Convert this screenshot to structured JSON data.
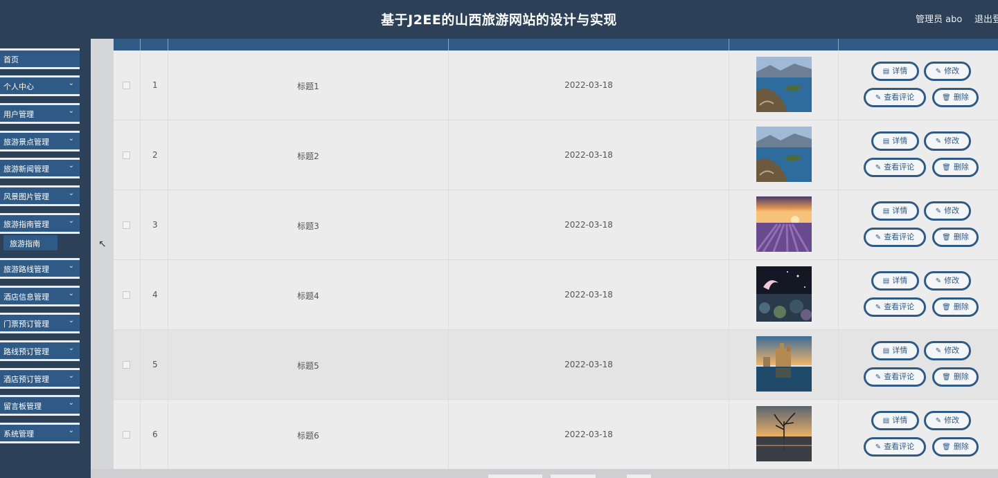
{
  "header": {
    "title": "基于J2EE的山西旅游网站的设计与实现",
    "user": "管理员 abo",
    "logout": "退出登"
  },
  "sidebar": {
    "items": [
      {
        "label": "首页",
        "has_chevron": false
      },
      {
        "label": "个人中心",
        "has_chevron": true
      },
      {
        "label": "用户管理",
        "has_chevron": true
      },
      {
        "label": "旅游景点管理",
        "has_chevron": true
      },
      {
        "label": "旅游新闻管理",
        "has_chevron": true
      },
      {
        "label": "风景图片管理",
        "has_chevron": true
      },
      {
        "label": "旅游指南管理",
        "has_chevron": true
      },
      {
        "label": "旅游路线管理",
        "has_chevron": true
      },
      {
        "label": "酒店信息管理",
        "has_chevron": true
      },
      {
        "label": "门票预订管理",
        "has_chevron": true
      },
      {
        "label": "路线预订管理",
        "has_chevron": true
      },
      {
        "label": "酒店预订管理",
        "has_chevron": true
      },
      {
        "label": "留言板管理",
        "has_chevron": true
      },
      {
        "label": "系统管理",
        "has_chevron": true
      }
    ],
    "submenu": {
      "label": "旅游指南"
    }
  },
  "buttons": {
    "detail": "详情",
    "edit": "修改",
    "comments": "查看评论",
    "delete": "删除"
  },
  "table": {
    "rows": [
      {
        "index": "1",
        "title": "标题1",
        "date": "2022-03-18",
        "image": "lake-peninsula"
      },
      {
        "index": "2",
        "title": "标题2",
        "date": "2022-03-18",
        "image": "lake-peninsula"
      },
      {
        "index": "3",
        "title": "标题3",
        "date": "2022-03-18",
        "image": "lavender-field"
      },
      {
        "index": "4",
        "title": "标题4",
        "date": "2022-03-18",
        "image": "night-garden"
      },
      {
        "index": "5",
        "title": "标题5",
        "date": "2022-03-18",
        "image": "castle-lake"
      },
      {
        "index": "6",
        "title": "标题6",
        "date": "2022-03-18",
        "image": "lone-tree-lake"
      }
    ]
  },
  "colors": {
    "header_bg": "#2c4157",
    "accent": "#2e5a85"
  }
}
